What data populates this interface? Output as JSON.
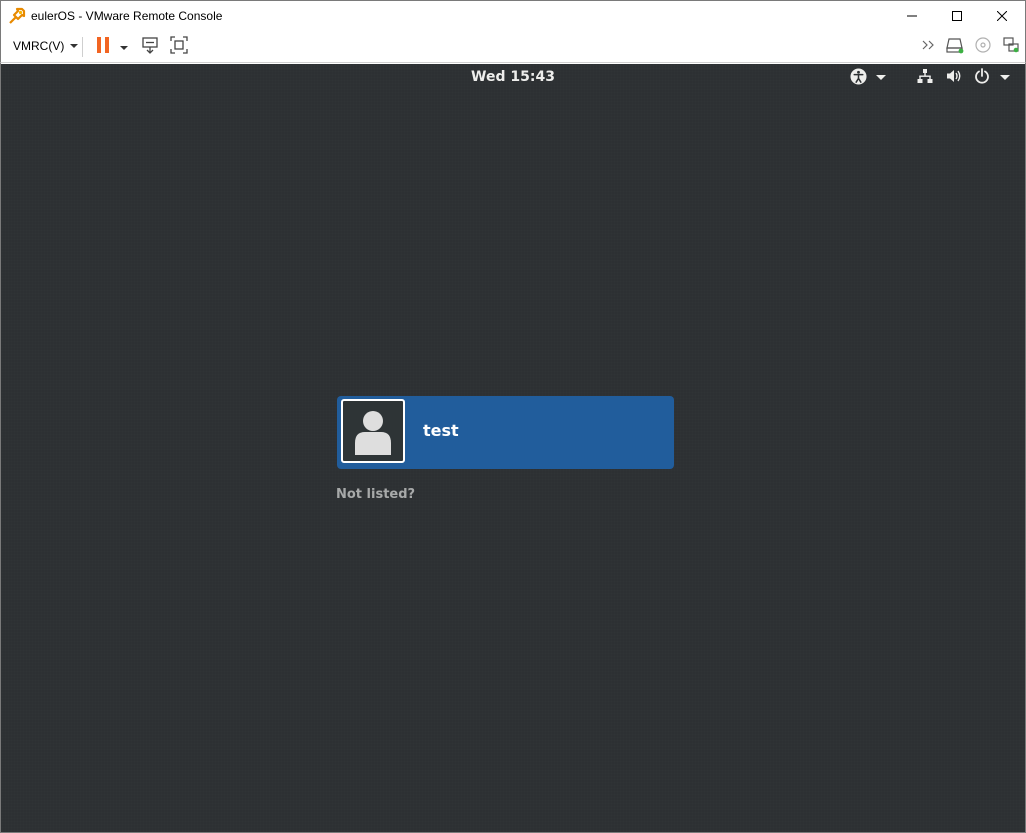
{
  "window": {
    "title": "eulerOS - VMware Remote Console",
    "app_icon": "vmware-icon",
    "controls": {
      "minimize": "minimize-icon",
      "maximize": "maximize-icon",
      "close": "close-icon"
    }
  },
  "toolbar": {
    "vmrc_menu_label": "VMRC(V)",
    "icons": [
      "pause-icon",
      "send-ctrl-alt-del-icon",
      "fullscreen-icon",
      "more-icon",
      "removable-devices-icon",
      "cd-icon",
      "usb-icon"
    ],
    "accent_color": "#f26522"
  },
  "guest": {
    "clock": "Wed 15:43",
    "status_icons": [
      "accessibility-icon",
      "network-icon",
      "volume-icon",
      "power-icon"
    ],
    "users": [
      {
        "name": "test"
      }
    ],
    "not_listed_label": "Not listed?",
    "colors": {
      "background": "#2d3033",
      "selected_user": "#215d9c",
      "text": "#eeeeec"
    }
  }
}
